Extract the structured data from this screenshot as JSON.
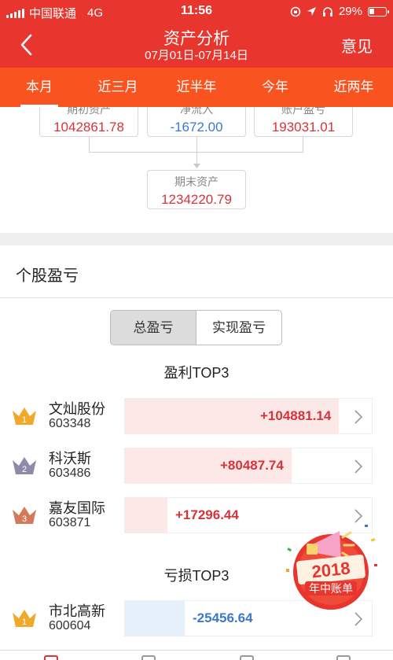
{
  "status_bar": {
    "carrier": "中国联通",
    "network": "4G",
    "time": "11:56",
    "battery": "29%",
    "battery_level": 0.29
  },
  "nav": {
    "title": "资产分析",
    "date_range": "07月01日-07月14日",
    "feedback_label": "意见",
    "back_icon": "chevron-left-icon"
  },
  "tabs": [
    {
      "label": "本月",
      "active": true
    },
    {
      "label": "近三月",
      "active": false
    },
    {
      "label": "近半年",
      "active": false
    },
    {
      "label": "今年",
      "active": false
    },
    {
      "label": "近两年",
      "active": false
    }
  ],
  "flow": {
    "start_assets": {
      "label": "期初资产",
      "value": "1042861.78"
    },
    "net_inflow": {
      "label": "净流入",
      "value": "-1672.00"
    },
    "profit_loss": {
      "label": "账户盈亏",
      "value": "193031.01"
    },
    "end_assets": {
      "label": "期末资产",
      "value": "1234220.79"
    }
  },
  "stocks": {
    "title": "个股盈亏",
    "segments": [
      {
        "label": "总盈亏",
        "active": true
      },
      {
        "label": "实现盈亏",
        "active": false
      }
    ],
    "profit_title": "盈利TOP3",
    "loss_title": "亏损TOP3",
    "profit_top": [
      {
        "rank": "1",
        "name": "文灿股份",
        "code": "603348",
        "amount": "+104881.14",
        "bar_fraction": 0.86,
        "crown_color": "#f0a92a"
      },
      {
        "rank": "2",
        "name": "科沃斯",
        "code": "603486",
        "amount": "+80487.74",
        "bar_fraction": 0.67,
        "crown_color": "#8e8aa8"
      },
      {
        "rank": "3",
        "name": "嘉友国际",
        "code": "603871",
        "amount": "+17296.44",
        "bar_fraction": 0.17,
        "crown_color": "#d47a5c"
      }
    ],
    "loss_top": [
      {
        "rank": "1",
        "name": "市北高新",
        "code": "600604",
        "amount": "-25456.64",
        "bar_fraction": 0.24,
        "crown_color": "#f0a92a"
      }
    ]
  },
  "badge": {
    "year": "2018",
    "label": "年中账单",
    "icon": "megaphone-icon"
  },
  "colors": {
    "primary_red": "#e8352d",
    "tab_orange": "#f95420",
    "profit_red": "#d9333a",
    "loss_blue": "#3b79c9"
  }
}
